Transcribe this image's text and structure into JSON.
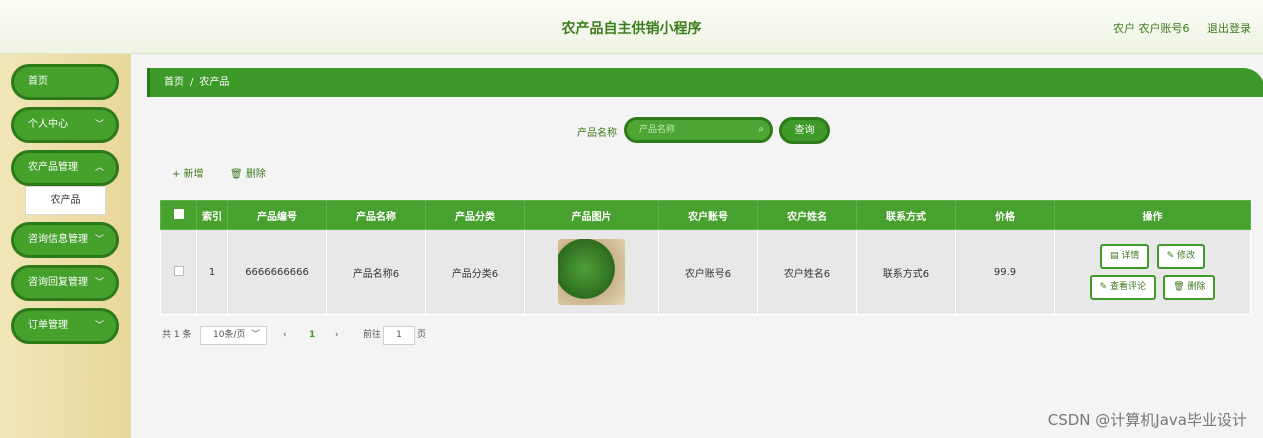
{
  "header": {
    "title": "农产品自主供销小程序",
    "user_label": "农户 农户账号6",
    "logout": "退出登录"
  },
  "sidebar": {
    "items": [
      {
        "label": "首页"
      },
      {
        "label": "个人中心"
      },
      {
        "label": "农产品管理"
      },
      {
        "label": "咨询信息管理"
      },
      {
        "label": "咨询回复管理"
      },
      {
        "label": "订单管理"
      }
    ],
    "submenu": "农产品"
  },
  "breadcrumb": {
    "home": "首页",
    "sep": "/",
    "current": "农产品"
  },
  "search": {
    "label": "产品名称",
    "placeholder": "产品名称",
    "button": "查询"
  },
  "toolbar": {
    "add": "+ 新增",
    "delete": "删除"
  },
  "table": {
    "headers": [
      "索引",
      "产品编号",
      "产品名称",
      "产品分类",
      "产品图片",
      "农户账号",
      "农户姓名",
      "联系方式",
      "价格",
      "操作"
    ],
    "rows": [
      {
        "index": "1",
        "code": "6666666666",
        "name": "产品名称6",
        "category": "产品分类6",
        "account": "农户账号6",
        "farmer": "农户姓名6",
        "contact": "联系方式6",
        "price": "99.9"
      }
    ],
    "actions": {
      "detail": "详情",
      "edit": "修改",
      "review": "查看评论",
      "delete": "删除"
    }
  },
  "pagination": {
    "total": "共 1 条",
    "page_size": "10条/页",
    "prev": "‹",
    "page": "1",
    "next": "›",
    "goto_prefix": "前往",
    "goto_value": "1",
    "goto_suffix": "页"
  },
  "watermark": "CSDN @计算机Java毕业设计",
  "colors": {
    "accent": "#45a02c",
    "accent_dark": "#2e7a1b",
    "sidebar_bg": "#e8d79a"
  }
}
